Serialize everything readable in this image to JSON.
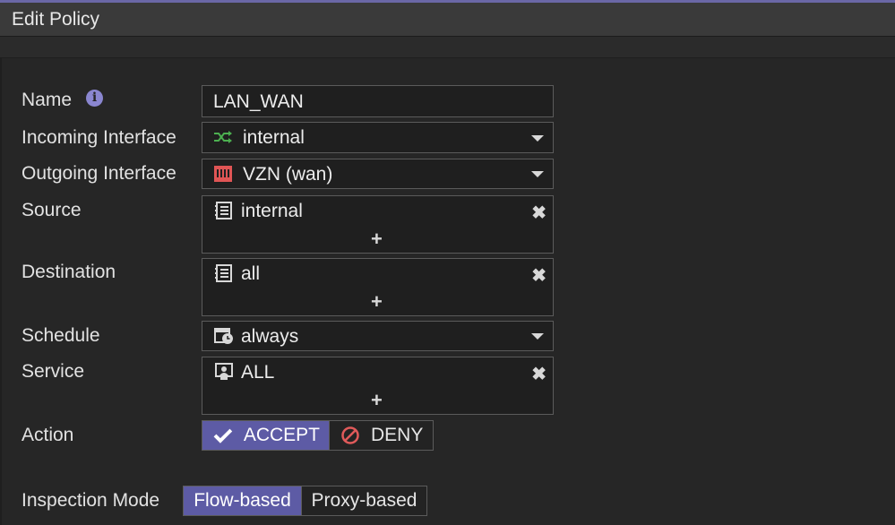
{
  "title": "Edit Policy",
  "form": {
    "name": {
      "label": "Name",
      "value": "LAN_WAN"
    },
    "incoming": {
      "label": "Incoming Interface",
      "value": "internal",
      "icon": "interface-shuffle-icon"
    },
    "outgoing": {
      "label": "Outgoing Interface",
      "value": "VZN (wan)",
      "icon": "wan-port-icon"
    },
    "source": {
      "label": "Source",
      "value": "internal",
      "icon": "address-book-icon"
    },
    "destination": {
      "label": "Destination",
      "value": "all",
      "icon": "address-book-icon"
    },
    "schedule": {
      "label": "Schedule",
      "value": "always",
      "icon": "calendar-clock-icon"
    },
    "service": {
      "label": "Service",
      "value": "ALL",
      "icon": "service-monitor-icon"
    },
    "action": {
      "label": "Action",
      "options": [
        "ACCEPT",
        "DENY"
      ],
      "selected": "ACCEPT"
    },
    "inspection": {
      "label": "Inspection Mode",
      "options": [
        "Flow-based",
        "Proxy-based"
      ],
      "selected": "Flow-based"
    }
  },
  "colors": {
    "accent": "#5d5ba5",
    "interface_green": "#4caf50",
    "wan_red": "#e05555",
    "deny_red": "#e05a5a"
  }
}
